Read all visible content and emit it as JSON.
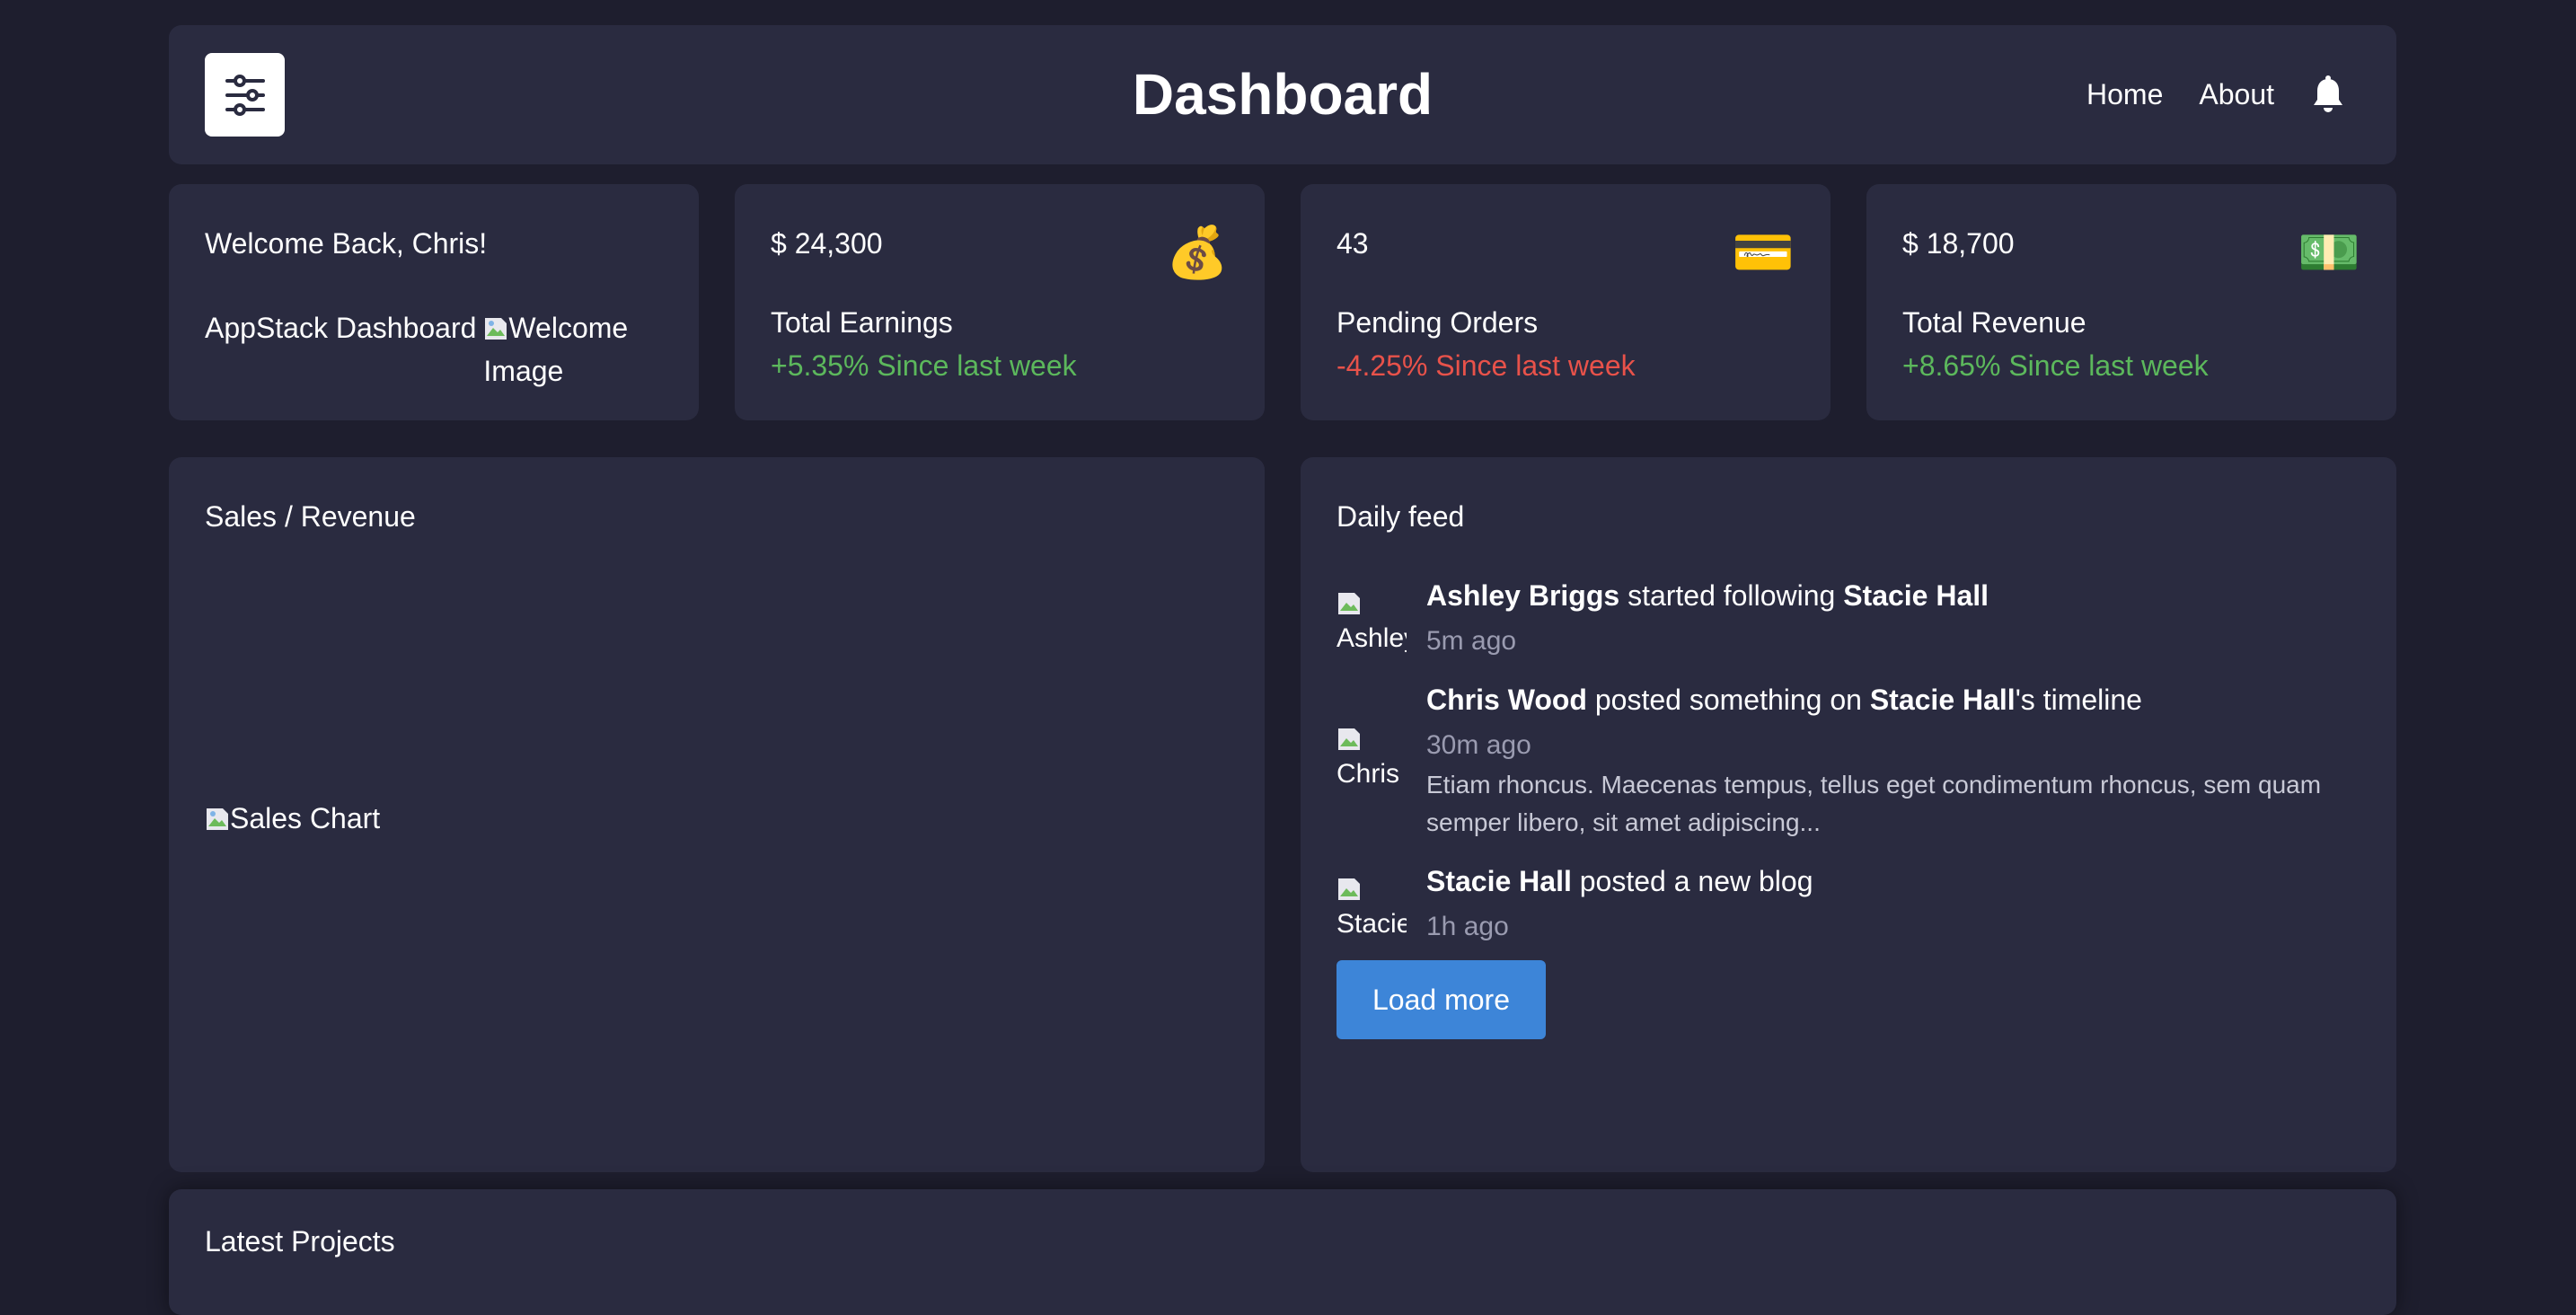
{
  "header": {
    "title": "Dashboard",
    "nav": [
      "Home",
      "About"
    ]
  },
  "welcome": {
    "greeting": "Welcome Back, Chris!",
    "app_name": "AppStack Dashboard",
    "image_alt": "Welcome Image"
  },
  "stats": [
    {
      "value": "$ 24,300",
      "label": "Total Earnings",
      "trend": "+5.35% Since last week",
      "emoji": "💰",
      "icon": "money-bag-icon",
      "direction": "up"
    },
    {
      "value": "43",
      "label": "Pending Orders",
      "trend": "-4.25% Since last week",
      "emoji": "💳",
      "icon": "credit-card-icon",
      "direction": "down"
    },
    {
      "value": "$ 18,700",
      "label": "Total Revenue",
      "trend": "+8.65% Since last week",
      "emoji": "💵",
      "icon": "banknote-icon",
      "direction": "up"
    }
  ],
  "sales": {
    "title": "Sales / Revenue",
    "chart_alt": "Sales Chart"
  },
  "feed": {
    "title": "Daily feed",
    "items": [
      {
        "avatar_alt": "Ashley",
        "actor": "Ashley Briggs",
        "action": " started following ",
        "target": "Stacie Hall",
        "suffix": "",
        "time": "5m ago"
      },
      {
        "avatar_alt": "Chris",
        "actor": "Chris Wood",
        "action": " posted something on ",
        "target": "Stacie Hall",
        "suffix": "'s timeline",
        "time": "30m ago",
        "excerpt": "Etiam rhoncus. Maecenas tempus, tellus eget condimentum rhoncus, sem quam semper libero, sit amet adipiscing..."
      },
      {
        "avatar_alt": "Stacie",
        "actor": "Stacie Hall",
        "action": " posted a new blog",
        "target": "",
        "suffix": "",
        "time": "1h ago"
      }
    ],
    "load_more": "Load more"
  },
  "projects": {
    "title": "Latest Projects"
  },
  "colors": {
    "background": "#1e1e2e",
    "card": "#2a2b40",
    "positive": "#5cb85c",
    "negative": "#e8524a",
    "primary": "#3d85d8"
  }
}
